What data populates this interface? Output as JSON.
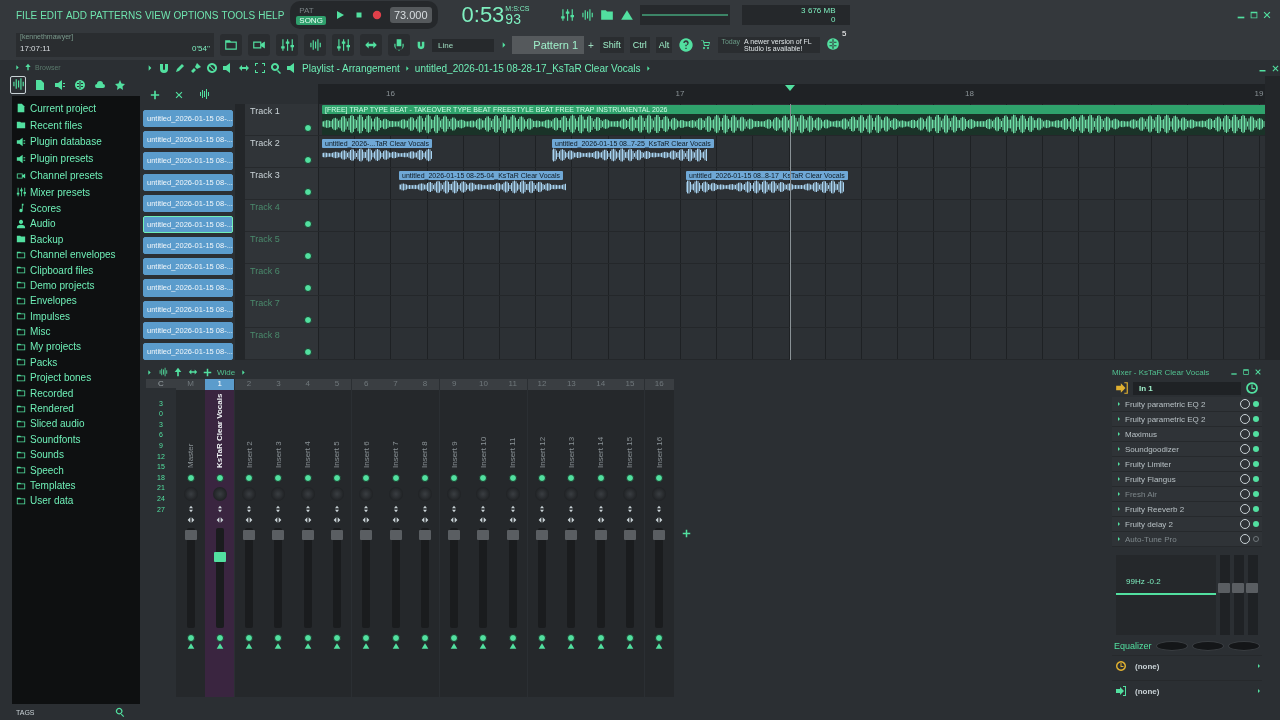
{
  "menu": [
    "FILE",
    "EDIT",
    "ADD",
    "PATTERNS",
    "VIEW",
    "OPTIONS",
    "TOOLS",
    "HELP"
  ],
  "transport": {
    "modes": [
      {
        "label": "PAT",
        "selected": false
      },
      {
        "label": "SONG",
        "selected": true
      }
    ],
    "tempo": "73.000",
    "time": "0:53",
    "time_cs": "93",
    "time_format": "M:S:CS"
  },
  "monitor": {
    "voices": "3",
    "memory": "676 MB",
    "value_3": "0"
  },
  "user": {
    "name": "[kennethmawyer]",
    "clock": "17:07:11",
    "project_time": "0'54''"
  },
  "snap": "Line",
  "pattern": "Pattern 1",
  "pattern_add": "+",
  "modifiers": [
    "Shift",
    "Ctrl",
    "Alt"
  ],
  "news": {
    "date": "Today",
    "message": "A newer version of FL Studio is available!",
    "badge": "5"
  },
  "browser": {
    "title": "Browser",
    "footer": "TAGS",
    "items": [
      {
        "label": "Current project",
        "kind": "project"
      },
      {
        "label": "Recent files",
        "kind": "sync"
      },
      {
        "label": "Plugin database",
        "kind": "plugin"
      },
      {
        "label": "Plugin presets",
        "kind": "plugin"
      },
      {
        "label": "Channel presets",
        "kind": "channel"
      },
      {
        "label": "Mixer presets",
        "kind": "mixer"
      },
      {
        "label": "Scores",
        "kind": "note"
      },
      {
        "label": "Audio",
        "kind": "audio"
      },
      {
        "label": "Backup",
        "kind": "sync"
      },
      {
        "label": "Channel envelopes",
        "kind": "folder-link"
      },
      {
        "label": "Clipboard files",
        "kind": "folder-link"
      },
      {
        "label": "Demo projects",
        "kind": "folder-link"
      },
      {
        "label": "Envelopes",
        "kind": "folder-link"
      },
      {
        "label": "Impulses",
        "kind": "folder-link"
      },
      {
        "label": "Misc",
        "kind": "folder"
      },
      {
        "label": "My projects",
        "kind": "folder-link"
      },
      {
        "label": "Packs",
        "kind": "folder-link"
      },
      {
        "label": "Project bones",
        "kind": "folder-link"
      },
      {
        "label": "Recorded",
        "kind": "folder-link"
      },
      {
        "label": "Rendered",
        "kind": "folder-link"
      },
      {
        "label": "Sliced audio",
        "kind": "folder-link"
      },
      {
        "label": "Soundfonts",
        "kind": "folder-link"
      },
      {
        "label": "Sounds",
        "kind": "folder-link"
      },
      {
        "label": "Speech",
        "kind": "folder-link"
      },
      {
        "label": "Templates",
        "kind": "folder-link"
      },
      {
        "label": "User data",
        "kind": "folder-link"
      }
    ]
  },
  "picker": {
    "items": [
      {
        "label": "untitled_2026-01-15 08-...",
        "selected": false
      },
      {
        "label": "untitled_2026-01-15 08-...",
        "selected": false
      },
      {
        "label": "untitled_2026-01-15 08-...",
        "selected": false
      },
      {
        "label": "untitled_2026-01-15 08-...",
        "selected": false
      },
      {
        "label": "untitled_2026-01-15 08-...",
        "selected": false
      },
      {
        "label": "untitled_2026-01-15 08-...",
        "selected": true
      },
      {
        "label": "untitled_2026-01-15 08-...",
        "selected": false
      },
      {
        "label": "untitled_2026-01-15 08-...",
        "selected": false
      },
      {
        "label": "untitled_2026-01-15 08-...",
        "selected": false
      },
      {
        "label": "untitled_2026-01-15 08-...",
        "selected": false
      },
      {
        "label": "untitled_2026-01-15 08-...",
        "selected": false
      },
      {
        "label": "untitled_2026-01-15 08-...",
        "selected": false
      }
    ]
  },
  "playlist": {
    "title": "Playlist - Arrangement",
    "pattern": "untitled_2026-01-15 08-28-17_KsTaR Clear Vocals",
    "ruler": [
      "16",
      "17",
      "18",
      "19"
    ],
    "tracks": [
      {
        "name": "Track 1",
        "empty": false,
        "clips": [
          {
            "name": "[FREE] TRAP TYPE BEAT - TAKEOVER  TYPE BEAT  FREESTYLE BEAT  FREE TRAP INSTRUMENTAL 2026",
            "color": "#2fa36c"
          }
        ]
      },
      {
        "name": "Track 2",
        "empty": false,
        "clips": [
          {
            "name": "untitled_2026-...TaR Clear Vocals",
            "color": "#6fa8d6"
          },
          {
            "name": "untitled_2026-01-15 08..7-25_KsTaR Clear Vocals",
            "color": "#6fa8d6"
          }
        ]
      },
      {
        "name": "Track 3",
        "empty": false,
        "clips": [
          {
            "name": "untitled_2026-01-15 08-25-04_KsTaR Clear Vocals",
            "color": "#6fa8d6"
          },
          {
            "name": "untitled_2026-01-15 08..8-17_KsTaR Clear Vocals",
            "color": "#6fa8d6"
          }
        ]
      },
      {
        "name": "Track 4",
        "empty": true
      },
      {
        "name": "Track 5",
        "empty": true
      },
      {
        "name": "Track 6",
        "empty": true
      },
      {
        "name": "Track 7",
        "empty": true
      },
      {
        "name": "Track 8",
        "empty": true
      }
    ]
  },
  "mixer": {
    "mode": "Wide",
    "current_label": "C",
    "scale": [
      "3",
      "0",
      "3",
      "6",
      "9",
      "12",
      "15",
      "18",
      "21",
      "24",
      "27"
    ],
    "strips": [
      {
        "number": "M",
        "name": "Master",
        "selected": false
      },
      {
        "number": "1",
        "name": "KsTaR Clear Vocals",
        "selected": true
      },
      {
        "number": "2",
        "name": "Insert 2",
        "selected": false
      },
      {
        "number": "3",
        "name": "Insert 3",
        "selected": false
      },
      {
        "number": "4",
        "name": "Insert 4",
        "selected": false
      },
      {
        "number": "5",
        "name": "Insert 5",
        "selected": false
      },
      {
        "number": "6",
        "name": "Insert 6",
        "selected": false
      },
      {
        "number": "7",
        "name": "Insert 7",
        "selected": false
      },
      {
        "number": "8",
        "name": "Insert 8",
        "selected": false
      },
      {
        "number": "9",
        "name": "Insert 9",
        "selected": false
      },
      {
        "number": "10",
        "name": "Insert 10",
        "selected": false
      },
      {
        "number": "11",
        "name": "Insert 11",
        "selected": false
      },
      {
        "number": "12",
        "name": "Insert 12",
        "selected": false
      },
      {
        "number": "13",
        "name": "Insert 13",
        "selected": false
      },
      {
        "number": "14",
        "name": "Insert 14",
        "selected": false
      },
      {
        "number": "15",
        "name": "Insert 15",
        "selected": false
      },
      {
        "number": "16",
        "name": "Insert 16",
        "selected": false
      }
    ]
  },
  "mixer_panel": {
    "title": "Mixer - KsTaR Clear Vocals",
    "input": "In 1",
    "slots": [
      {
        "name": "Fruity parametric EQ 2",
        "on": true,
        "disabled": false
      },
      {
        "name": "Fruity parametric EQ 2",
        "on": true,
        "disabled": false
      },
      {
        "name": "Maximus",
        "on": true,
        "disabled": false
      },
      {
        "name": "Soundgoodizer",
        "on": true,
        "disabled": false
      },
      {
        "name": "Fruity Limiter",
        "on": true,
        "disabled": false
      },
      {
        "name": "Fruity Flangus",
        "on": true,
        "disabled": false
      },
      {
        "name": "Fresh Air",
        "on": true,
        "disabled": true
      },
      {
        "name": "Fruity Reeverb 2",
        "on": true,
        "disabled": false
      },
      {
        "name": "Fruity delay 2",
        "on": true,
        "disabled": false
      },
      {
        "name": "Auto-Tune Pro",
        "on": false,
        "disabled": true
      }
    ],
    "eq_reading": "99Hz -0.2",
    "eq_label": "Equalizer",
    "routes": [
      "(none)",
      "(none)"
    ]
  }
}
